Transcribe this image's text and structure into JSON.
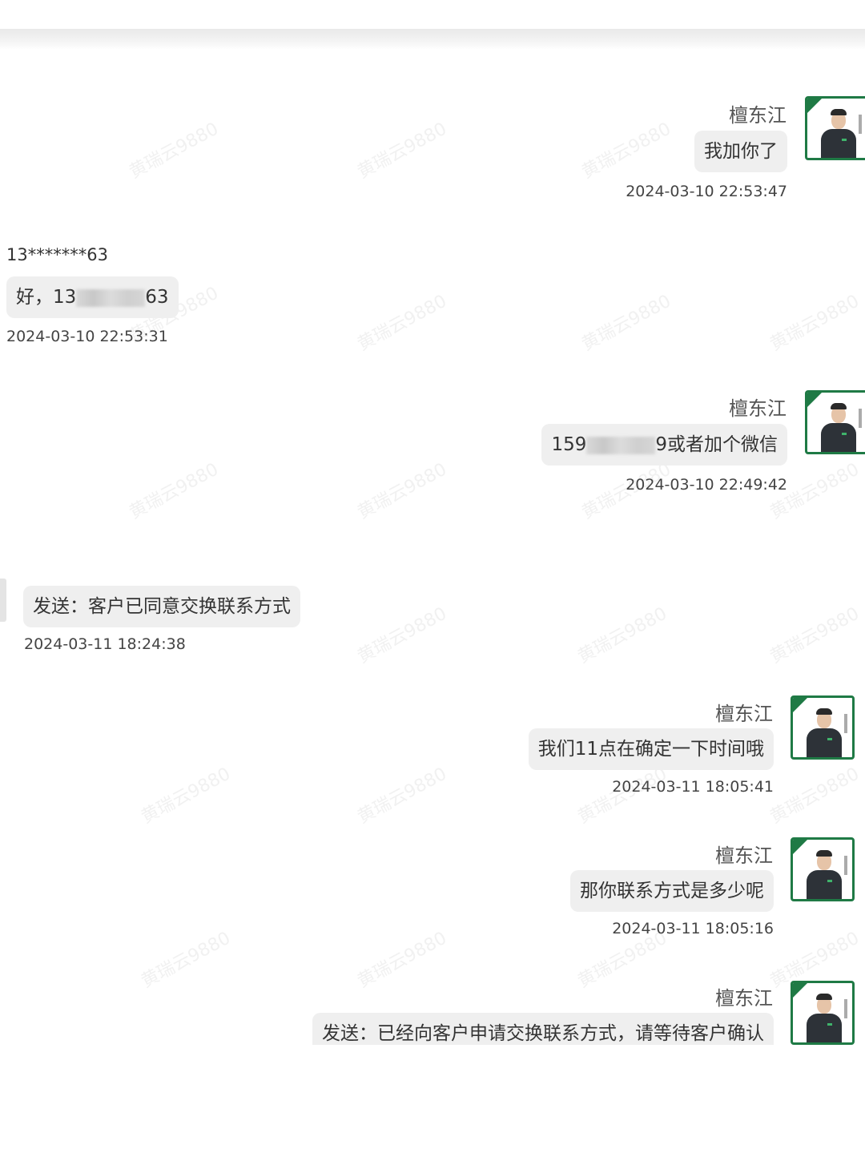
{
  "watermark": "黄瑞云9880",
  "messages": [
    {
      "side": "right",
      "sender": "檀东江",
      "text": "我加你了",
      "time": "2024-03-10 22:53:47"
    },
    {
      "side": "left",
      "sender": "13*******63",
      "text_prefix": "好，13",
      "text_suffix": "63",
      "time": "2024-03-10 22:53:31"
    },
    {
      "side": "right",
      "sender": "檀东江",
      "text_prefix": "159",
      "text_suffix": "9或者加个微信",
      "time": "2024-03-10 22:49:42"
    },
    {
      "side": "left",
      "text": "发送：客户已同意交换联系方式",
      "time": "2024-03-11 18:24:38"
    },
    {
      "side": "right",
      "sender": "檀东江",
      "text": "我们11点在确定一下时间哦",
      "time": "2024-03-11 18:05:41"
    },
    {
      "side": "right",
      "sender": "檀东江",
      "text": "那你联系方式是多少呢",
      "time": "2024-03-11 18:05:16"
    },
    {
      "side": "right",
      "sender": "檀东江",
      "text": "发送：已经向客户申请交换联系方式，请等待客户确认"
    }
  ],
  "colors": {
    "bubble": "#efefef",
    "avatar_border": "#1f7a45"
  },
  "icons": {
    "avatar": "user-avatar-icon"
  }
}
